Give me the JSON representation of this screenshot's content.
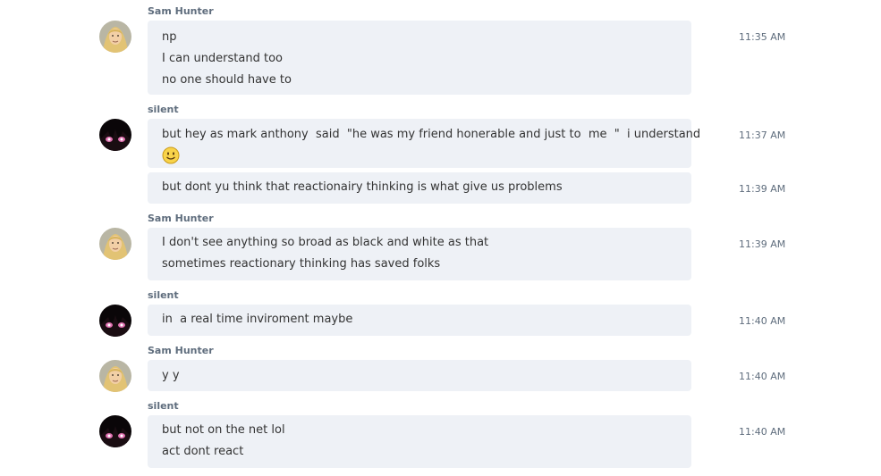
{
  "messages": [
    {
      "sender": "Sam Hunter",
      "avatar_icon": "blonde-person-avatar",
      "groups": [
        {
          "lines": [
            "np",
            "I can understand too",
            "no one should have to"
          ],
          "time": "11:35 AM"
        }
      ]
    },
    {
      "sender": "silent",
      "avatar_icon": "dark-anime-eyes-avatar",
      "groups": [
        {
          "lines": [
            "but hey as mark anthony  said  \"he was my friend honerable and just to  me  \"  i understand"
          ],
          "emoji": "smiley-face",
          "time": "11:37 AM"
        },
        {
          "lines": [
            "but dont yu think that reactionairy thinking is what give us problems"
          ],
          "time": "11:39 AM"
        }
      ]
    },
    {
      "sender": "Sam Hunter",
      "avatar_icon": "blonde-person-avatar",
      "groups": [
        {
          "lines": [
            "I don't see anything so broad as black and white as that",
            "sometimes reactionary thinking has saved folks"
          ],
          "time": "11:39 AM"
        }
      ]
    },
    {
      "sender": "silent",
      "avatar_icon": "dark-anime-eyes-avatar",
      "groups": [
        {
          "lines": [
            "in  a real time inviroment maybe"
          ],
          "time": "11:40 AM"
        }
      ]
    },
    {
      "sender": "Sam Hunter",
      "avatar_icon": "blonde-person-avatar",
      "groups": [
        {
          "lines": [
            "y y"
          ],
          "time": "11:40 AM"
        }
      ]
    },
    {
      "sender": "silent",
      "avatar_icon": "dark-anime-eyes-avatar",
      "groups": [
        {
          "lines": [
            "but not on the net lol",
            "act dont react"
          ],
          "time": "11:40 AM"
        }
      ]
    }
  ],
  "colors": {
    "bubble": "#eef1f6",
    "name": "#5f6d7d",
    "text": "#333333",
    "time": "#5f6d7d"
  }
}
